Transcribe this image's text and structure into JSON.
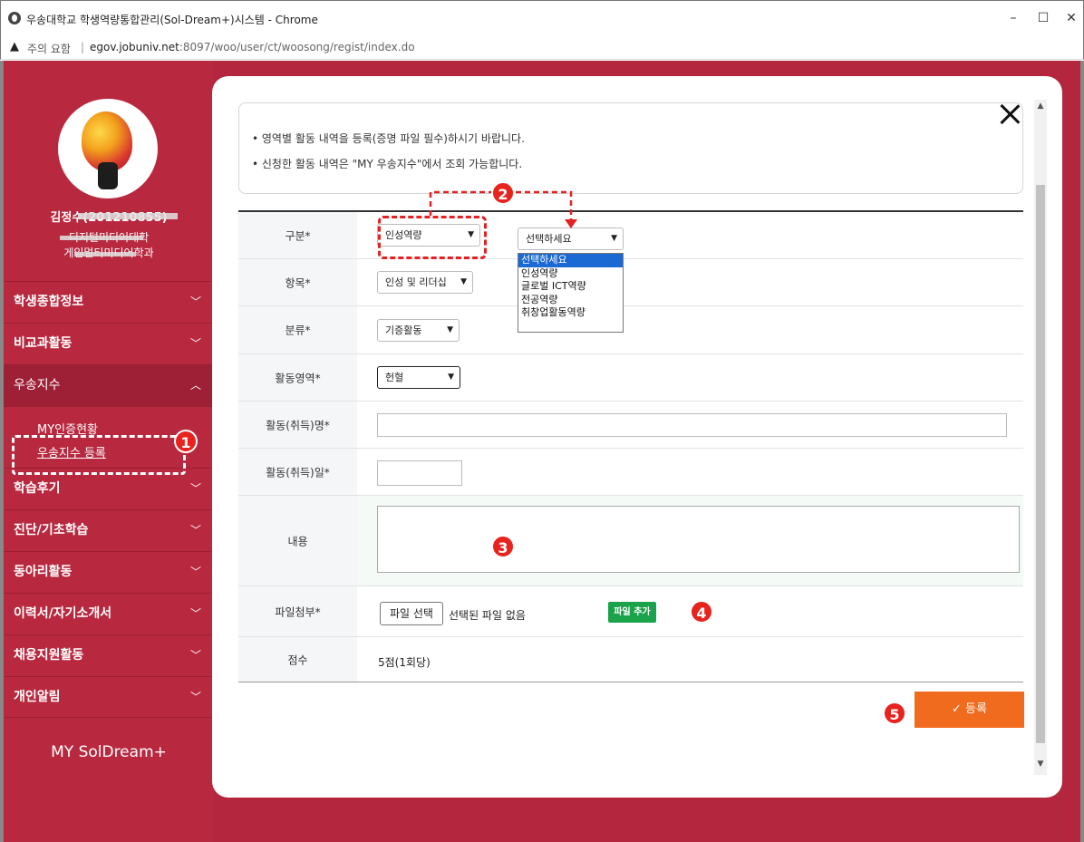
{
  "window": {
    "title": "우송대학교 학생역량통합관리(Sol-Dream+)시스템 - Chrome",
    "minimize": "–",
    "maximize": "☐",
    "close": "✕"
  },
  "address": {
    "warning_icon": "▲",
    "warning": "주의 요함",
    "separator": "|",
    "host": "egov.jobuniv.net",
    "path": ":8097/woo/user/ct/woosong/regist/index.do"
  },
  "sidebar": {
    "user_name": "김정수(201210855)",
    "college": "디지털미디어대학",
    "department": "게임멀티미디어학과",
    "menu": [
      {
        "label": "학생종합정보",
        "chevron": "﹀"
      },
      {
        "label": "비교과활동",
        "chevron": "﹀"
      },
      {
        "label": "우송지수",
        "chevron": "︿"
      },
      {
        "label": "학습후기",
        "chevron": "﹀"
      },
      {
        "label": "진단/기초학습",
        "chevron": "﹀"
      },
      {
        "label": "동아리활동",
        "chevron": "﹀"
      },
      {
        "label": "이력서/자기소개서",
        "chevron": "﹀"
      },
      {
        "label": "채용지원활동",
        "chevron": "﹀"
      },
      {
        "label": "개인알림",
        "chevron": "﹀"
      }
    ],
    "submenu": {
      "my_cert": "MY인증현황",
      "register": "우송지수 등록"
    },
    "brand": "MY SolDream+"
  },
  "notice": {
    "line1": "• 영역별 활동 내역을 등록(증명 파일 필수)하시기 바랍니다.",
    "line2": "• 신청한 활동 내역은 \"MY 우송지수\"에서 조회 가능합니다."
  },
  "form": {
    "labels": {
      "category": "구분*",
      "item": "항목*",
      "classification": "분류*",
      "area": "활동영역*",
      "name": "활동(취득)명*",
      "date": "활동(취득)일*",
      "content": "내용",
      "file": "파일첨부*",
      "score": "점수"
    },
    "category_value": "인성역량",
    "category_secondary_value": "선택하세요",
    "dropdown_options": [
      "선택하세요",
      "인성역량",
      "글로벌 ICT역량",
      "전공역량",
      "취창업활동역량"
    ],
    "item_value": "인성 및 리더십",
    "classification_value": "기증활동",
    "area_value": "헌혈",
    "file_button": "파일 선택",
    "file_status": "선택된 파일 없음",
    "add_file": "파일 추가",
    "score_value": "5점(1회당)",
    "submit": "✓ 등록"
  },
  "annotations": [
    "1",
    "2",
    "3",
    "4",
    "5"
  ],
  "colors": {
    "brand_red": "#b8283f",
    "submit_orange": "#f06b1d",
    "add_file_green": "#1aa34a",
    "badge_red": "#e8221d"
  }
}
